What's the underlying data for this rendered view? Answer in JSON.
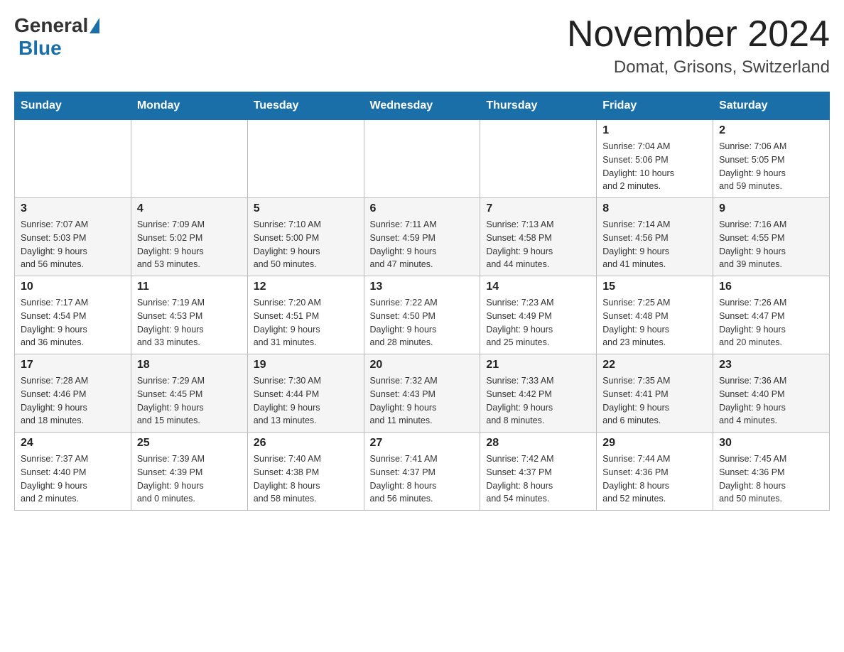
{
  "logo": {
    "general": "General",
    "blue": "Blue"
  },
  "title": {
    "month_year": "November 2024",
    "location": "Domat, Grisons, Switzerland"
  },
  "days_of_week": [
    "Sunday",
    "Monday",
    "Tuesday",
    "Wednesday",
    "Thursday",
    "Friday",
    "Saturday"
  ],
  "weeks": [
    {
      "days": [
        {
          "num": "",
          "info": ""
        },
        {
          "num": "",
          "info": ""
        },
        {
          "num": "",
          "info": ""
        },
        {
          "num": "",
          "info": ""
        },
        {
          "num": "",
          "info": ""
        },
        {
          "num": "1",
          "info": "Sunrise: 7:04 AM\nSunset: 5:06 PM\nDaylight: 10 hours\nand 2 minutes."
        },
        {
          "num": "2",
          "info": "Sunrise: 7:06 AM\nSunset: 5:05 PM\nDaylight: 9 hours\nand 59 minutes."
        }
      ]
    },
    {
      "days": [
        {
          "num": "3",
          "info": "Sunrise: 7:07 AM\nSunset: 5:03 PM\nDaylight: 9 hours\nand 56 minutes."
        },
        {
          "num": "4",
          "info": "Sunrise: 7:09 AM\nSunset: 5:02 PM\nDaylight: 9 hours\nand 53 minutes."
        },
        {
          "num": "5",
          "info": "Sunrise: 7:10 AM\nSunset: 5:00 PM\nDaylight: 9 hours\nand 50 minutes."
        },
        {
          "num": "6",
          "info": "Sunrise: 7:11 AM\nSunset: 4:59 PM\nDaylight: 9 hours\nand 47 minutes."
        },
        {
          "num": "7",
          "info": "Sunrise: 7:13 AM\nSunset: 4:58 PM\nDaylight: 9 hours\nand 44 minutes."
        },
        {
          "num": "8",
          "info": "Sunrise: 7:14 AM\nSunset: 4:56 PM\nDaylight: 9 hours\nand 41 minutes."
        },
        {
          "num": "9",
          "info": "Sunrise: 7:16 AM\nSunset: 4:55 PM\nDaylight: 9 hours\nand 39 minutes."
        }
      ]
    },
    {
      "days": [
        {
          "num": "10",
          "info": "Sunrise: 7:17 AM\nSunset: 4:54 PM\nDaylight: 9 hours\nand 36 minutes."
        },
        {
          "num": "11",
          "info": "Sunrise: 7:19 AM\nSunset: 4:53 PM\nDaylight: 9 hours\nand 33 minutes."
        },
        {
          "num": "12",
          "info": "Sunrise: 7:20 AM\nSunset: 4:51 PM\nDaylight: 9 hours\nand 31 minutes."
        },
        {
          "num": "13",
          "info": "Sunrise: 7:22 AM\nSunset: 4:50 PM\nDaylight: 9 hours\nand 28 minutes."
        },
        {
          "num": "14",
          "info": "Sunrise: 7:23 AM\nSunset: 4:49 PM\nDaylight: 9 hours\nand 25 minutes."
        },
        {
          "num": "15",
          "info": "Sunrise: 7:25 AM\nSunset: 4:48 PM\nDaylight: 9 hours\nand 23 minutes."
        },
        {
          "num": "16",
          "info": "Sunrise: 7:26 AM\nSunset: 4:47 PM\nDaylight: 9 hours\nand 20 minutes."
        }
      ]
    },
    {
      "days": [
        {
          "num": "17",
          "info": "Sunrise: 7:28 AM\nSunset: 4:46 PM\nDaylight: 9 hours\nand 18 minutes."
        },
        {
          "num": "18",
          "info": "Sunrise: 7:29 AM\nSunset: 4:45 PM\nDaylight: 9 hours\nand 15 minutes."
        },
        {
          "num": "19",
          "info": "Sunrise: 7:30 AM\nSunset: 4:44 PM\nDaylight: 9 hours\nand 13 minutes."
        },
        {
          "num": "20",
          "info": "Sunrise: 7:32 AM\nSunset: 4:43 PM\nDaylight: 9 hours\nand 11 minutes."
        },
        {
          "num": "21",
          "info": "Sunrise: 7:33 AM\nSunset: 4:42 PM\nDaylight: 9 hours\nand 8 minutes."
        },
        {
          "num": "22",
          "info": "Sunrise: 7:35 AM\nSunset: 4:41 PM\nDaylight: 9 hours\nand 6 minutes."
        },
        {
          "num": "23",
          "info": "Sunrise: 7:36 AM\nSunset: 4:40 PM\nDaylight: 9 hours\nand 4 minutes."
        }
      ]
    },
    {
      "days": [
        {
          "num": "24",
          "info": "Sunrise: 7:37 AM\nSunset: 4:40 PM\nDaylight: 9 hours\nand 2 minutes."
        },
        {
          "num": "25",
          "info": "Sunrise: 7:39 AM\nSunset: 4:39 PM\nDaylight: 9 hours\nand 0 minutes."
        },
        {
          "num": "26",
          "info": "Sunrise: 7:40 AM\nSunset: 4:38 PM\nDaylight: 8 hours\nand 58 minutes."
        },
        {
          "num": "27",
          "info": "Sunrise: 7:41 AM\nSunset: 4:37 PM\nDaylight: 8 hours\nand 56 minutes."
        },
        {
          "num": "28",
          "info": "Sunrise: 7:42 AM\nSunset: 4:37 PM\nDaylight: 8 hours\nand 54 minutes."
        },
        {
          "num": "29",
          "info": "Sunrise: 7:44 AM\nSunset: 4:36 PM\nDaylight: 8 hours\nand 52 minutes."
        },
        {
          "num": "30",
          "info": "Sunrise: 7:45 AM\nSunset: 4:36 PM\nDaylight: 8 hours\nand 50 minutes."
        }
      ]
    }
  ]
}
